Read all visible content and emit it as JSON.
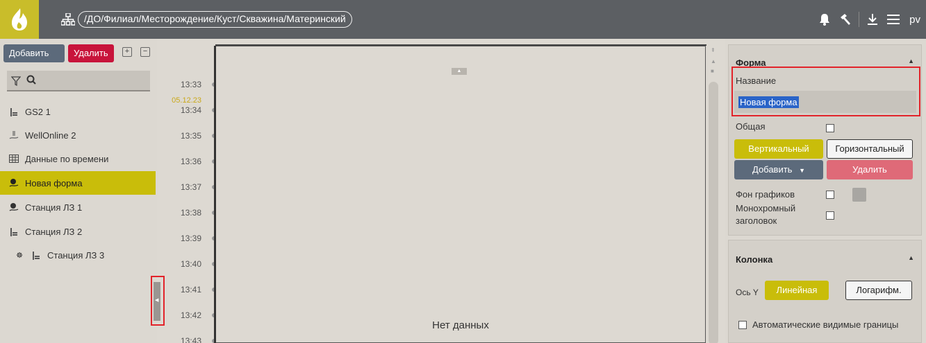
{
  "topbar": {
    "path": "/ДО/Филиал/Месторождение/Куст/Скважина/Материнский",
    "user": "pv",
    "icons": [
      "fire-logo-icon",
      "hierarchy-icon",
      "bell-icon",
      "hammer-icon",
      "download-icon",
      "menu-icon"
    ]
  },
  "left": {
    "add_label": "Добавить",
    "delete_label": "Удалить",
    "tree": [
      {
        "label": "GS2 1",
        "icon": "station-icon"
      },
      {
        "label": "WellOnline 2",
        "icon": "well-icon"
      },
      {
        "label": "Данные по времени",
        "icon": "table-icon"
      },
      {
        "label": "Новая форма",
        "icon": "form-icon",
        "selected": true
      },
      {
        "label": "Станция ЛЗ 1",
        "icon": "form-icon"
      },
      {
        "label": "Станция ЛЗ 2",
        "icon": "station-icon"
      },
      {
        "label": "Станция ЛЗ 3",
        "icon": "station-icon",
        "extra_icon": "group-icon"
      }
    ]
  },
  "timeline": {
    "date": "05.12.23",
    "times": [
      "13:33",
      "13:34",
      "13:35",
      "13:36",
      "13:37",
      "13:38",
      "13:39",
      "13:40",
      "13:41",
      "13:42",
      "13:43"
    ]
  },
  "chart": {
    "no_data": "Нет данных"
  },
  "right": {
    "form": {
      "title": "Форма",
      "name_label": "Название",
      "name_value": "Новая форма",
      "common_label": "Общая",
      "vertical": "Вертикальный",
      "horizontal": "Горизонтальный",
      "add": "Добавить",
      "delete": "Удалить",
      "chart_bg": "Фон графиков",
      "mono_header_1": "Монохромный",
      "mono_header_2": "заголовок"
    },
    "column": {
      "title": "Колонка",
      "axis_y": "Ось Y",
      "linear": "Линейная",
      "log": "Логарифм.",
      "auto_bounds": "Автоматические видимые границы"
    }
  },
  "colors": {
    "accent_yellow": "#c9bd0a",
    "danger_red": "#c8143b",
    "topbar": "#5c5f63"
  }
}
